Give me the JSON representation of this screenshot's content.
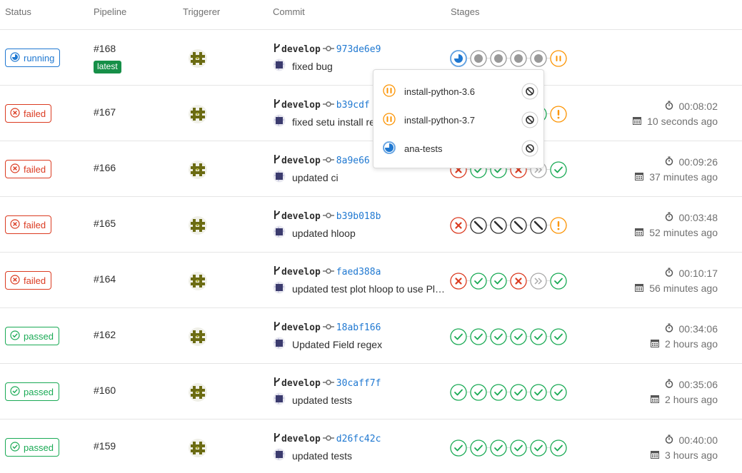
{
  "header": {
    "status": "Status",
    "pipeline": "Pipeline",
    "triggerer": "Triggerer",
    "commit": "Commit",
    "stages": "Stages"
  },
  "colors": {
    "running": "#1f78d1",
    "failed": "#db3b21",
    "passed": "#1aaa55",
    "manual": "#fc9403",
    "pending": "#999999",
    "skipped": "#2e2e2e",
    "latest_badge": "#168f48",
    "sha_link": "#1f78d1"
  },
  "rows": [
    {
      "status": "running",
      "id": "#168",
      "latest": "latest",
      "branch": "develop",
      "sha": "973de6e9",
      "message": "fixed bug",
      "stages": [
        "running",
        "pending",
        "pending",
        "pending",
        "pending",
        "manual"
      ],
      "duration": "",
      "finished": ""
    },
    {
      "status": "failed",
      "id": "#167",
      "latest": "",
      "branch": "develop",
      "sha": "b39cdf",
      "message": "fixed setu install re",
      "stages": [
        "failed",
        "passed",
        "passed",
        "failed",
        "passed",
        "warning"
      ],
      "duration": "00:08:02",
      "finished": "10 seconds ago"
    },
    {
      "status": "failed",
      "id": "#166",
      "latest": "",
      "branch": "develop",
      "sha": "8a9e66",
      "message": "updated ci",
      "stages": [
        "failed",
        "passed",
        "passed",
        "failed",
        "skipped-arrows",
        "passed"
      ],
      "duration": "00:09:26",
      "finished": "37 minutes ago"
    },
    {
      "status": "failed",
      "id": "#165",
      "latest": "",
      "branch": "develop",
      "sha": "b39b018b",
      "message": "updated hloop",
      "stages": [
        "failed",
        "skipped",
        "skipped",
        "skipped",
        "skipped",
        "warning"
      ],
      "duration": "00:03:48",
      "finished": "52 minutes ago"
    },
    {
      "status": "failed",
      "id": "#164",
      "latest": "",
      "branch": "develop",
      "sha": "faed388a",
      "message": "updated test plot hloop to use Pl…",
      "stages": [
        "failed",
        "passed",
        "passed",
        "failed",
        "skipped-arrows",
        "passed"
      ],
      "duration": "00:10:17",
      "finished": "56 minutes ago"
    },
    {
      "status": "passed",
      "id": "#162",
      "latest": "",
      "branch": "develop",
      "sha": "18abf166",
      "message": "Updated Field regex",
      "stages": [
        "passed",
        "passed",
        "passed",
        "passed",
        "passed",
        "passed"
      ],
      "duration": "00:34:06",
      "finished": "2 hours ago"
    },
    {
      "status": "passed",
      "id": "#160",
      "latest": "",
      "branch": "develop",
      "sha": "30caff7f",
      "message": "updated tests",
      "stages": [
        "passed",
        "passed",
        "passed",
        "passed",
        "passed",
        "passed"
      ],
      "duration": "00:35:06",
      "finished": "2 hours ago"
    },
    {
      "status": "passed",
      "id": "#159",
      "latest": "",
      "branch": "develop",
      "sha": "d26fc42c",
      "message": "updated tests",
      "stages": [
        "passed",
        "passed",
        "passed",
        "passed",
        "passed",
        "passed"
      ],
      "duration": "00:40:00",
      "finished": "3 hours ago"
    }
  ],
  "popup": {
    "jobs": [
      {
        "name": "install-python-3.6",
        "status": "manual"
      },
      {
        "name": "install-python-3.7",
        "status": "manual"
      },
      {
        "name": "ana-tests",
        "status": "running"
      }
    ]
  }
}
